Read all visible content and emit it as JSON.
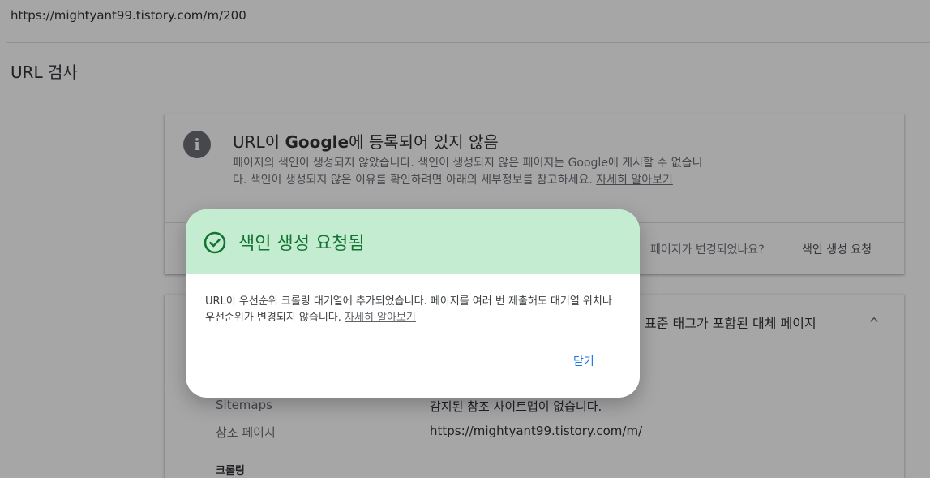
{
  "url_bar": {
    "url": "https://mightyant99.tistory.com/m/200"
  },
  "page": {
    "title": "URL 검사"
  },
  "status_card": {
    "heading_prefix": "URL이 ",
    "heading_brand": "Google",
    "heading_suffix": "에 등록되어 있지 않음",
    "description": "페이지의 색인이 생성되지 않았습니다. 색인이 생성되지 않은 페이지는 Google에 게시할 수 없습니다. 색인이 생성되지 않은 이유를 확인하려면 아래의 세부정보를 참고하세요.",
    "learn_more": "자세히 알아보기",
    "changed_question": "페이지가 변경되었나요?",
    "request_index": "색인 생성 요청"
  },
  "detail_card": {
    "title": "표준 태그가 포함된 대체 페이지",
    "rows": [
      {
        "label": "Sitemaps",
        "value": "감지된 참조 사이트맵이 없습니다."
      },
      {
        "label": "참조 페이지",
        "value": "https://mightyant99.tistory.com/m/"
      }
    ],
    "section": "크롤링"
  },
  "dialog": {
    "title": "색인 생성 요청됨",
    "body": "URL이 우선순위 크롤링 대기열에 추가되었습니다. 페이지를 여러 번 제출해도 대기열 위치나 우선순위가 변경되지 않습니다.",
    "learn_more": "자세히 알아보기",
    "close": "닫기",
    "header_color": "#c4ecd0",
    "title_color": "#137333"
  },
  "icons": {
    "info": "info-icon",
    "check": "check-circle-icon",
    "chevron": "chevron-up-icon"
  },
  "colors": {
    "link": "#1a73e8",
    "scrim": "rgba(32,33,36,0.40)"
  }
}
